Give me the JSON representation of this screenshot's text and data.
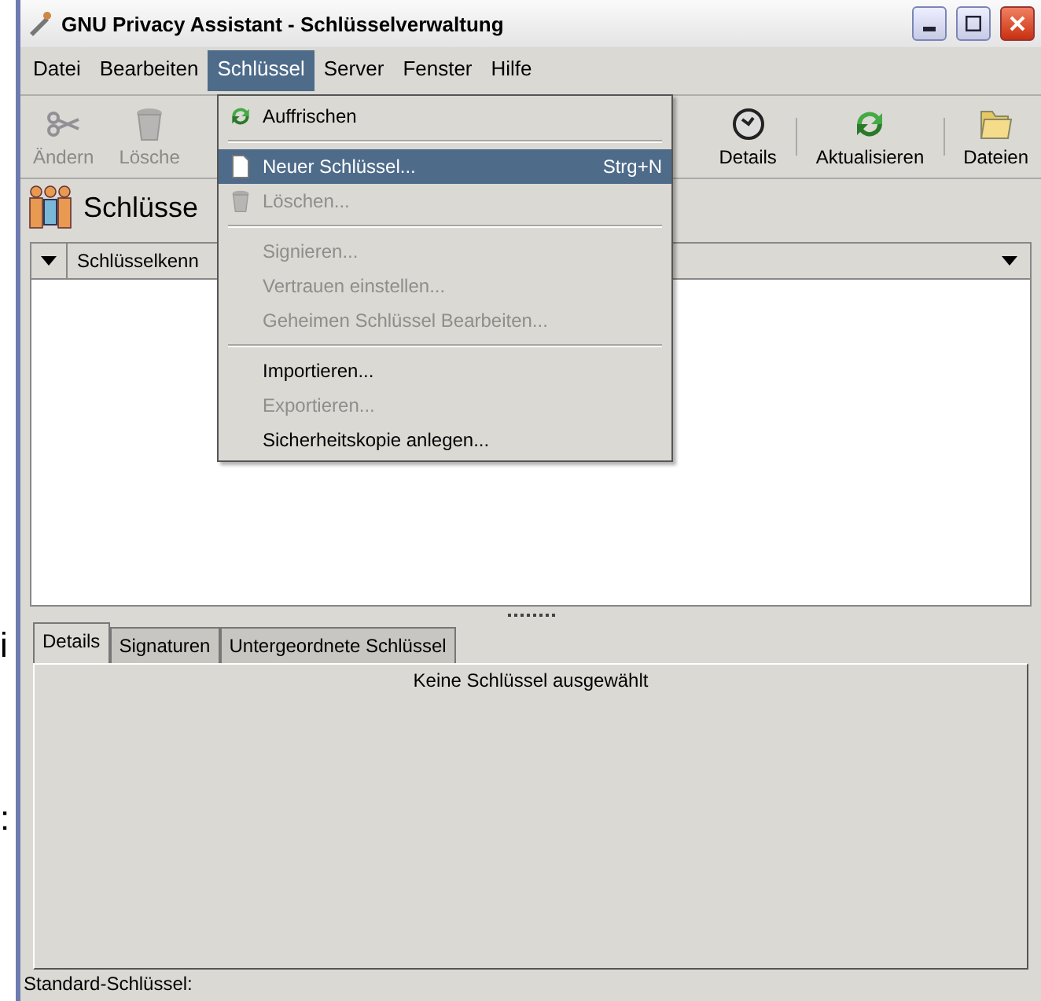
{
  "background_text": [
    "i",
    ":"
  ],
  "window": {
    "title": "GNU Privacy Assistant - Schlüsselverwaltung"
  },
  "menubar": [
    {
      "label": "Datei",
      "selected": false
    },
    {
      "label": "Bearbeiten",
      "selected": false
    },
    {
      "label": "Schlüssel",
      "selected": true
    },
    {
      "label": "Server",
      "selected": false
    },
    {
      "label": "Fenster",
      "selected": false
    },
    {
      "label": "Hilfe",
      "selected": false
    }
  ],
  "toolbar_left": [
    {
      "label": "Ändern",
      "disabled": true
    },
    {
      "label": "Lösche",
      "disabled": true
    }
  ],
  "toolbar_right": [
    {
      "label": "Details",
      "disabled": false
    },
    {
      "label": "Aktualisieren",
      "disabled": false
    },
    {
      "label": "Dateien",
      "disabled": false
    }
  ],
  "heading": "Schlüsse",
  "list_header": {
    "column_1": "Schlüsselkenn"
  },
  "menu": [
    {
      "kind": "item",
      "label": "Auffrischen",
      "disabled": false,
      "selected": false
    },
    {
      "kind": "separator"
    },
    {
      "kind": "item",
      "label": "Neuer Schlüssel...",
      "shortcut": "Strg+N",
      "disabled": false,
      "selected": true
    },
    {
      "kind": "item",
      "label": "Löschen...",
      "disabled": true,
      "selected": false
    },
    {
      "kind": "separator"
    },
    {
      "kind": "item",
      "label": "Signieren...",
      "disabled": true,
      "selected": false
    },
    {
      "kind": "item",
      "label": "Vertrauen einstellen...",
      "disabled": true,
      "selected": false
    },
    {
      "kind": "item",
      "label": "Geheimen Schlüssel Bearbeiten...",
      "disabled": true,
      "selected": false
    },
    {
      "kind": "separator"
    },
    {
      "kind": "item",
      "label": "Importieren...",
      "disabled": false,
      "selected": false
    },
    {
      "kind": "item",
      "label": "Exportieren...",
      "disabled": true,
      "selected": false
    },
    {
      "kind": "item",
      "label": "Sicherheitskopie anlegen...",
      "disabled": false,
      "selected": false
    }
  ],
  "tabs": [
    {
      "label": "Details",
      "selected": true
    },
    {
      "label": "Signaturen",
      "selected": false
    },
    {
      "label": "Untergeordnete Schlüssel",
      "selected": false
    }
  ],
  "details_message": "Keine Schlüssel ausgewählt",
  "status_bar": "Standard-Schlüssel:"
}
